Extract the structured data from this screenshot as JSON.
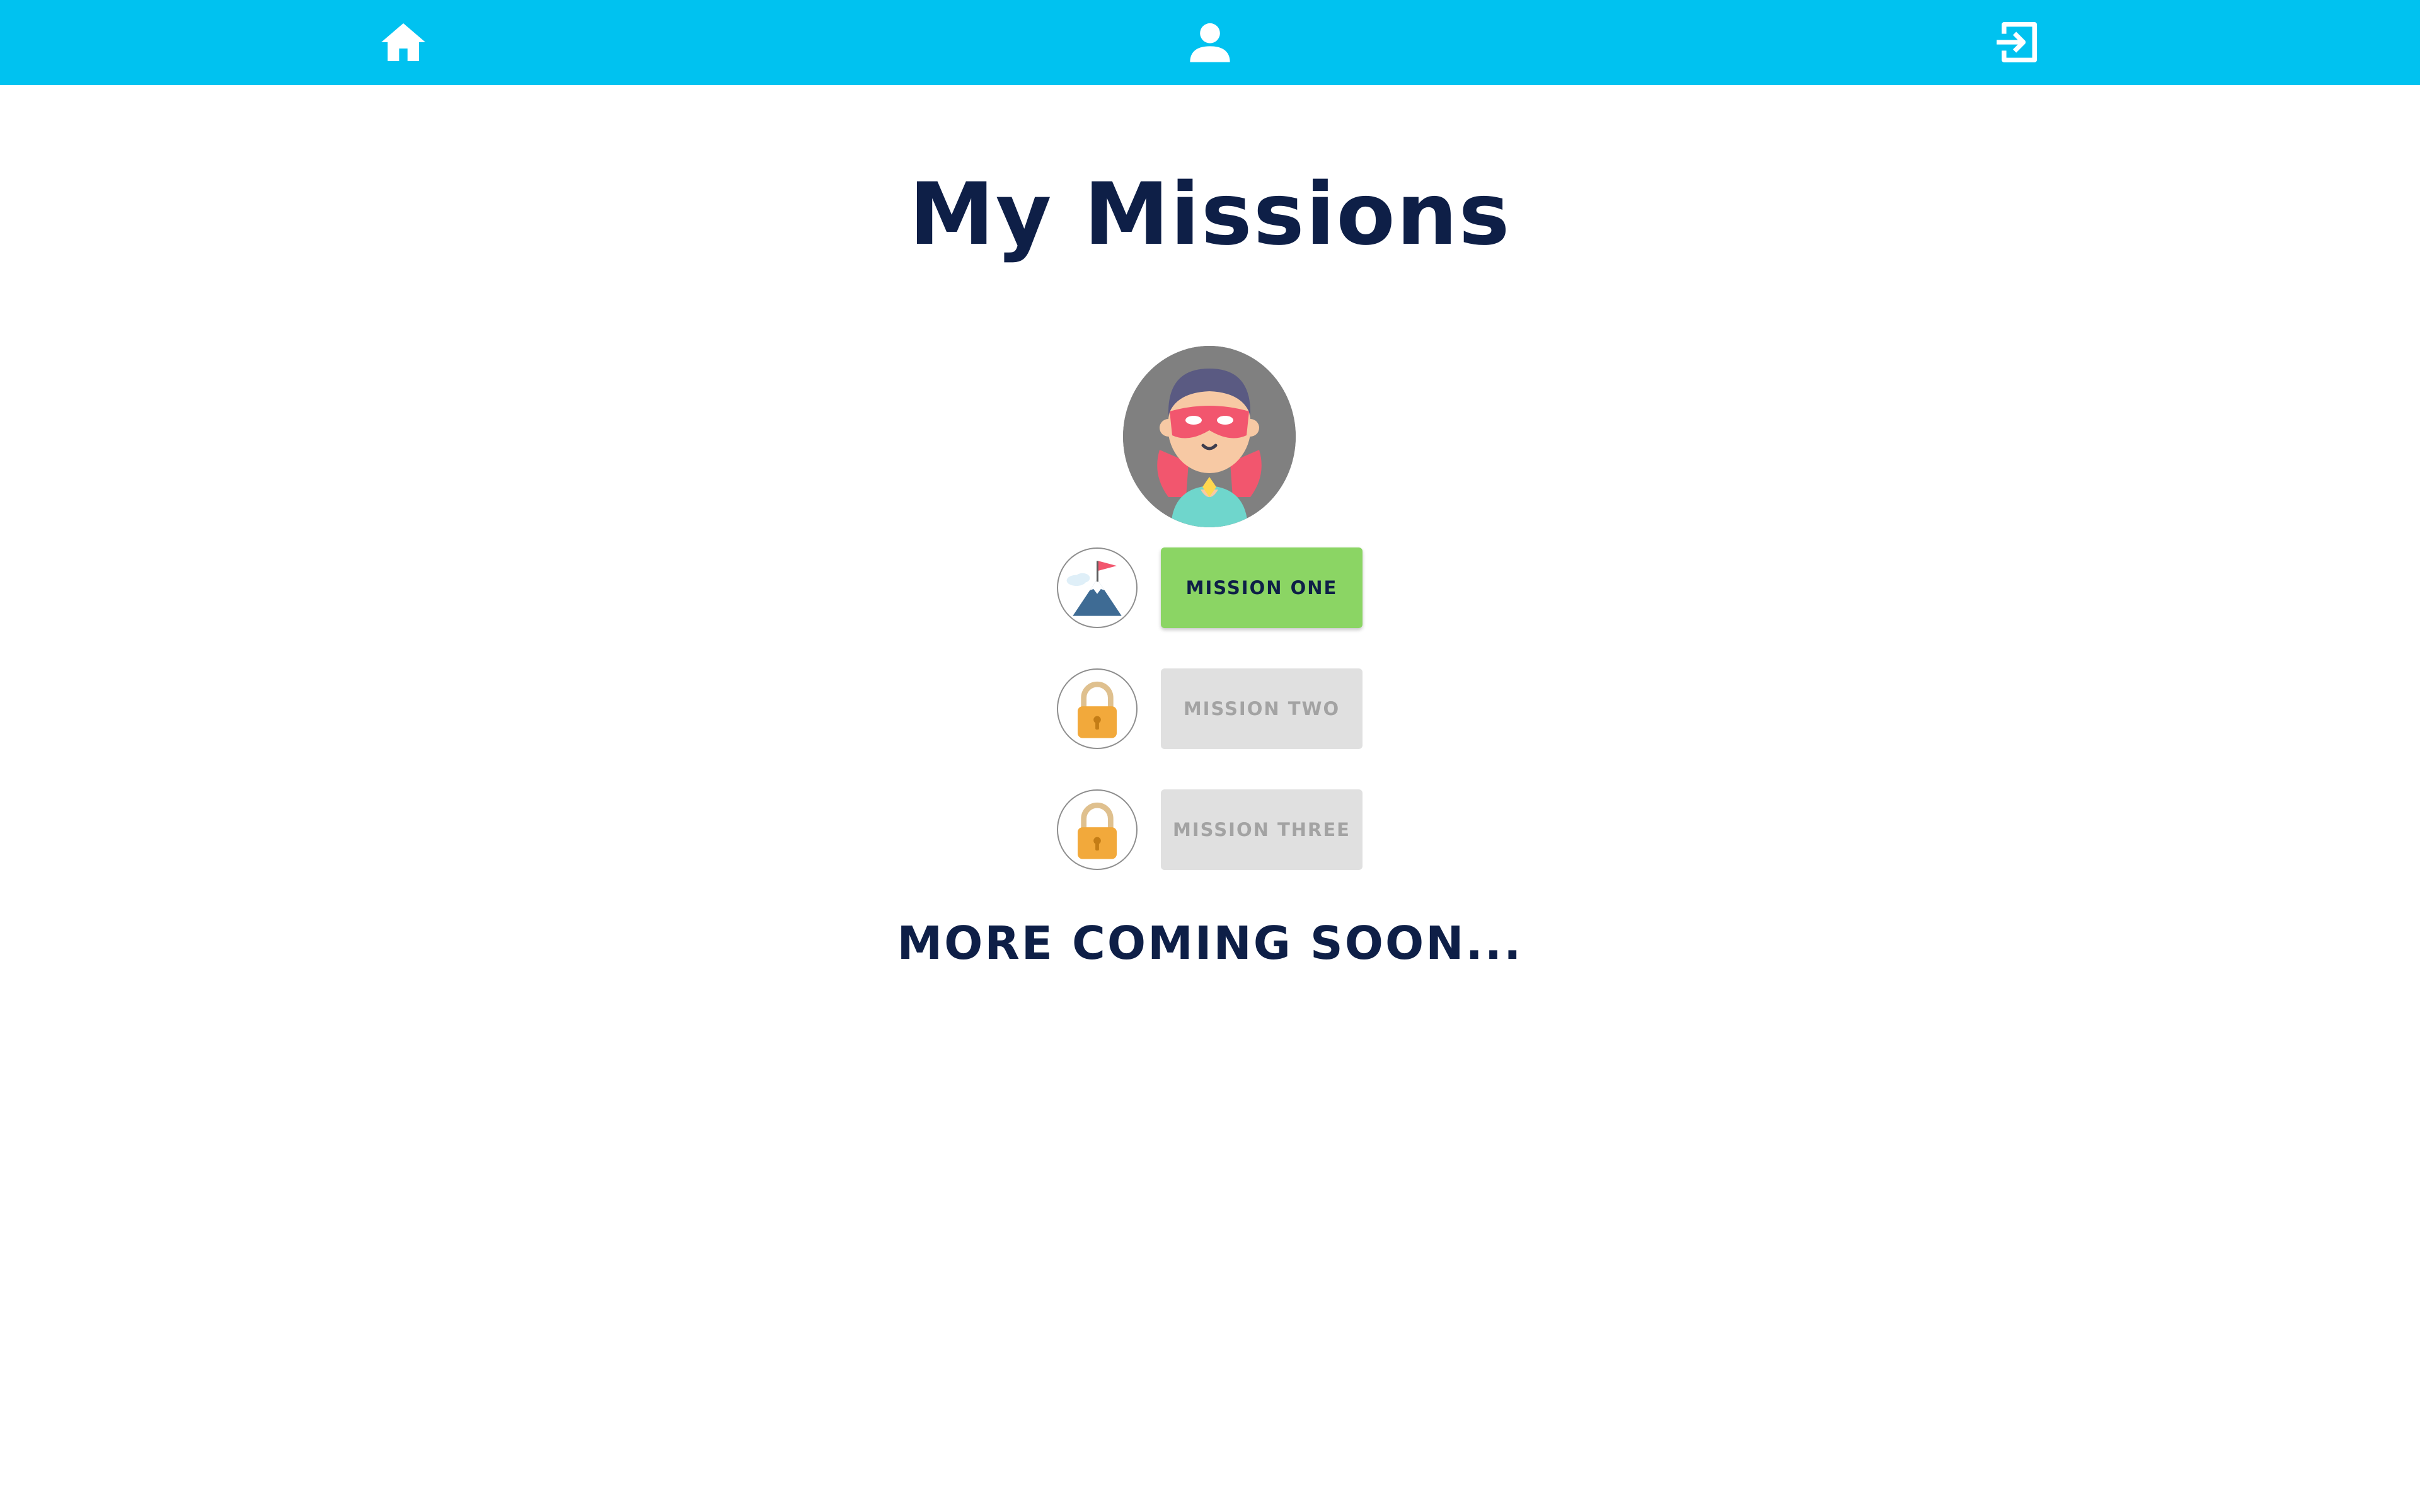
{
  "topbar": {
    "background": "#00c2f0",
    "items": [
      {
        "icon": "home-icon"
      },
      {
        "icon": "user-icon"
      },
      {
        "icon": "logout-icon"
      }
    ]
  },
  "page": {
    "title": "My Missions",
    "avatar_icon": "superhero-avatar-icon",
    "footer_text": "MORE COMING SOON..."
  },
  "missions": [
    {
      "label": "MISSION ONE",
      "state": "unlocked",
      "icon": "mountain-flag-icon",
      "color": "#8bd564"
    },
    {
      "label": "MISSION TWO",
      "state": "locked",
      "icon": "lock-icon",
      "color": "#e0e0e0"
    },
    {
      "label": "MISSION THREE",
      "state": "locked",
      "icon": "lock-icon",
      "color": "#e0e0e0"
    }
  ],
  "colors": {
    "heading": "#0e1f47",
    "lock": "#f2a93b"
  }
}
